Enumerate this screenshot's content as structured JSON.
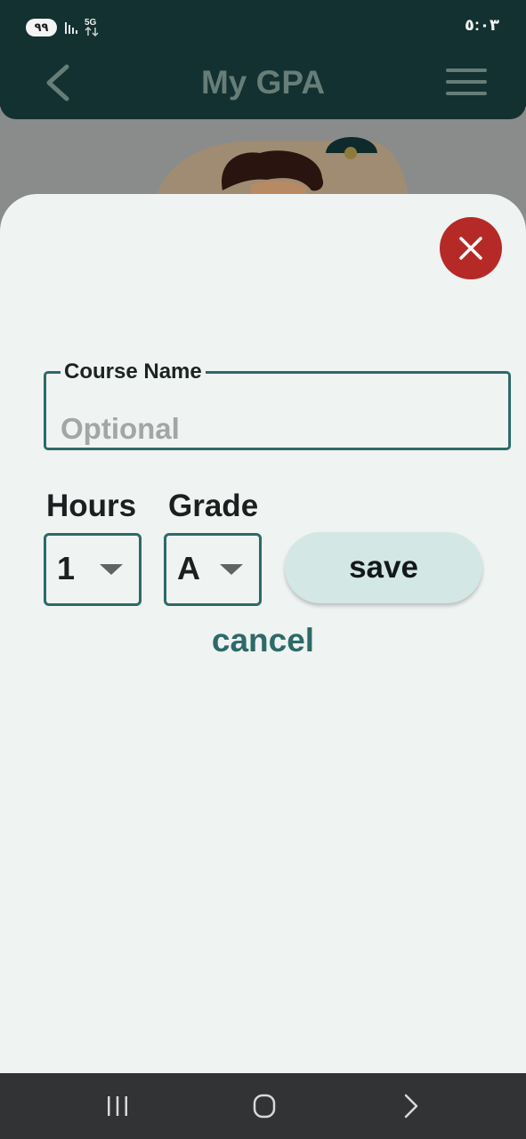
{
  "status_bar": {
    "battery": "٩٩",
    "network": "5G",
    "time": "٥:٠٣"
  },
  "header": {
    "title": "My GPA"
  },
  "form": {
    "course_name_label": "Course Name",
    "course_name_placeholder": "Optional",
    "course_name_value": "",
    "hours_label": "Hours",
    "hours_value": "1",
    "grade_label": "Grade",
    "grade_value": "A",
    "save_label": "save",
    "cancel_label": "cancel"
  },
  "colors": {
    "header_bg": "#133130",
    "accent": "#2d6a68",
    "close_red": "#b52a27",
    "save_bg": "#d3e7e5",
    "sheet_bg": "#eff3f2"
  },
  "icons": {
    "back": "chevron-left-icon",
    "menu": "hamburger-menu-icon",
    "close": "close-icon",
    "dropdown": "caret-down-icon"
  }
}
